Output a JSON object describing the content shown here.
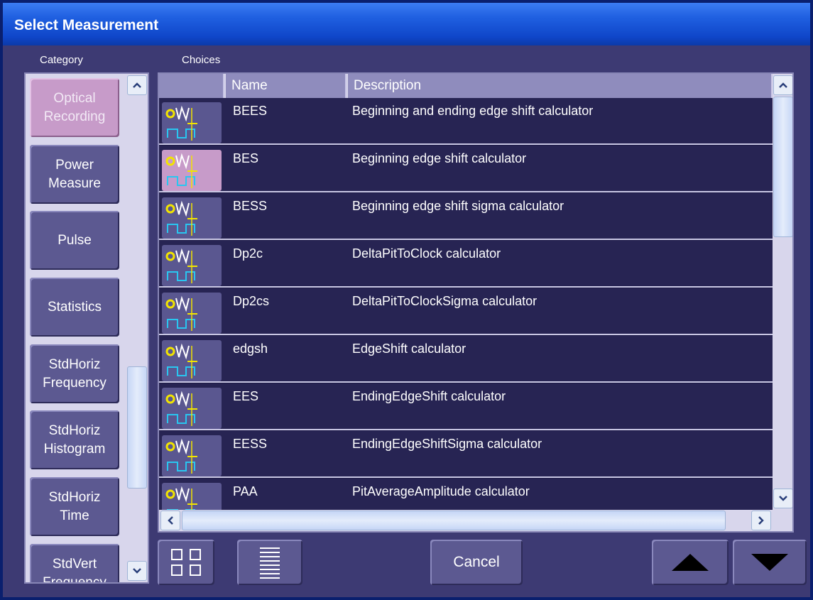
{
  "window": {
    "title": "Select Measurement"
  },
  "category": {
    "label": "Category",
    "items": [
      {
        "label": "Optical Recording",
        "active": true
      },
      {
        "label": "Power Measure"
      },
      {
        "label": "Pulse"
      },
      {
        "label": "Statistics"
      },
      {
        "label": "StdHoriz Frequency"
      },
      {
        "label": "StdHoriz Histogram"
      },
      {
        "label": "StdHoriz Time"
      },
      {
        "label": "StdVert Frequency"
      }
    ]
  },
  "choices": {
    "label": "Choices",
    "columns": {
      "icon": "",
      "name": "Name",
      "description": "Description"
    },
    "rows": [
      {
        "name": "BEES",
        "description": "Beginning and ending edge shift calculator",
        "icon": "edge-shift-icon"
      },
      {
        "name": "BES",
        "description": "Beginning edge shift calculator",
        "icon": "edge-shift-icon",
        "selected": true
      },
      {
        "name": "BESS",
        "description": "Beginning edge shift sigma  calculator",
        "icon": "edge-shift-sigma-icon"
      },
      {
        "name": "Dp2c",
        "description": "DeltaPitToClock  calculator",
        "icon": "edge-shift-icon"
      },
      {
        "name": "Dp2cs",
        "description": "DeltaPitToClockSigma calculator",
        "icon": "edge-shift-sigma-icon"
      },
      {
        "name": "edgsh",
        "description": "EdgeShift calculator",
        "icon": "edge-shift-icon"
      },
      {
        "name": "EES",
        "description": "EndingEdgeShift calculator",
        "icon": "ending-edge-shift-icon"
      },
      {
        "name": "EESS",
        "description": "EndingEdgeShiftSigma calculator",
        "icon": "ending-edge-shift-sigma-icon"
      },
      {
        "name": "PAA",
        "description": "PitAverageAmplitude calculator",
        "icon": "pit-amplitude-icon"
      }
    ]
  },
  "buttons": {
    "cancel": "Cancel",
    "grid_view_icon": "grid-view-icon",
    "list_view_icon": "list-view-icon",
    "up_icon": "arrow-up-icon",
    "down_icon": "arrow-down-icon"
  },
  "colors": {
    "title_bar": "#1f5fe0",
    "panel_bg": "#3d3a73",
    "active_category": "#c79bc9",
    "row_bg": "#272453",
    "header_bg": "#8f8cbd"
  }
}
